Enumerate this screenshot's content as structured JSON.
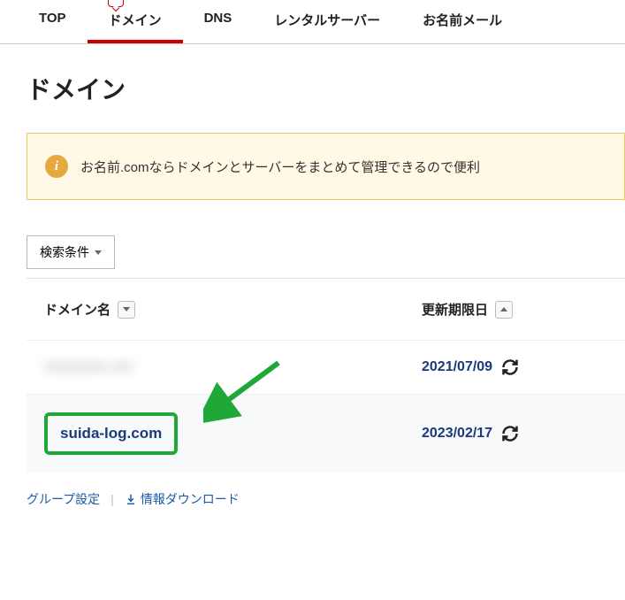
{
  "nav": {
    "items": [
      {
        "label": "TOP"
      },
      {
        "label": "ドメイン"
      },
      {
        "label": "DNS"
      },
      {
        "label": "レンタルサーバー"
      },
      {
        "label": "お名前メール"
      }
    ],
    "active_index": 1
  },
  "page_title": "ドメイン",
  "info_banner": "お名前.comならドメインとサーバーをまとめて管理できるので便利",
  "filter_button": "検索条件",
  "table": {
    "headers": {
      "domain": "ドメイン名",
      "expiry": "更新期限日"
    },
    "rows": [
      {
        "domain": "xxxxxxxxx.xxx",
        "expiry": "2021/07/09",
        "blurred": true
      },
      {
        "domain": "suida-log.com",
        "expiry": "2023/02/17",
        "highlighted": true
      }
    ]
  },
  "footer": {
    "group_settings": "グループ設定",
    "download_info": "情報ダウンロード"
  }
}
